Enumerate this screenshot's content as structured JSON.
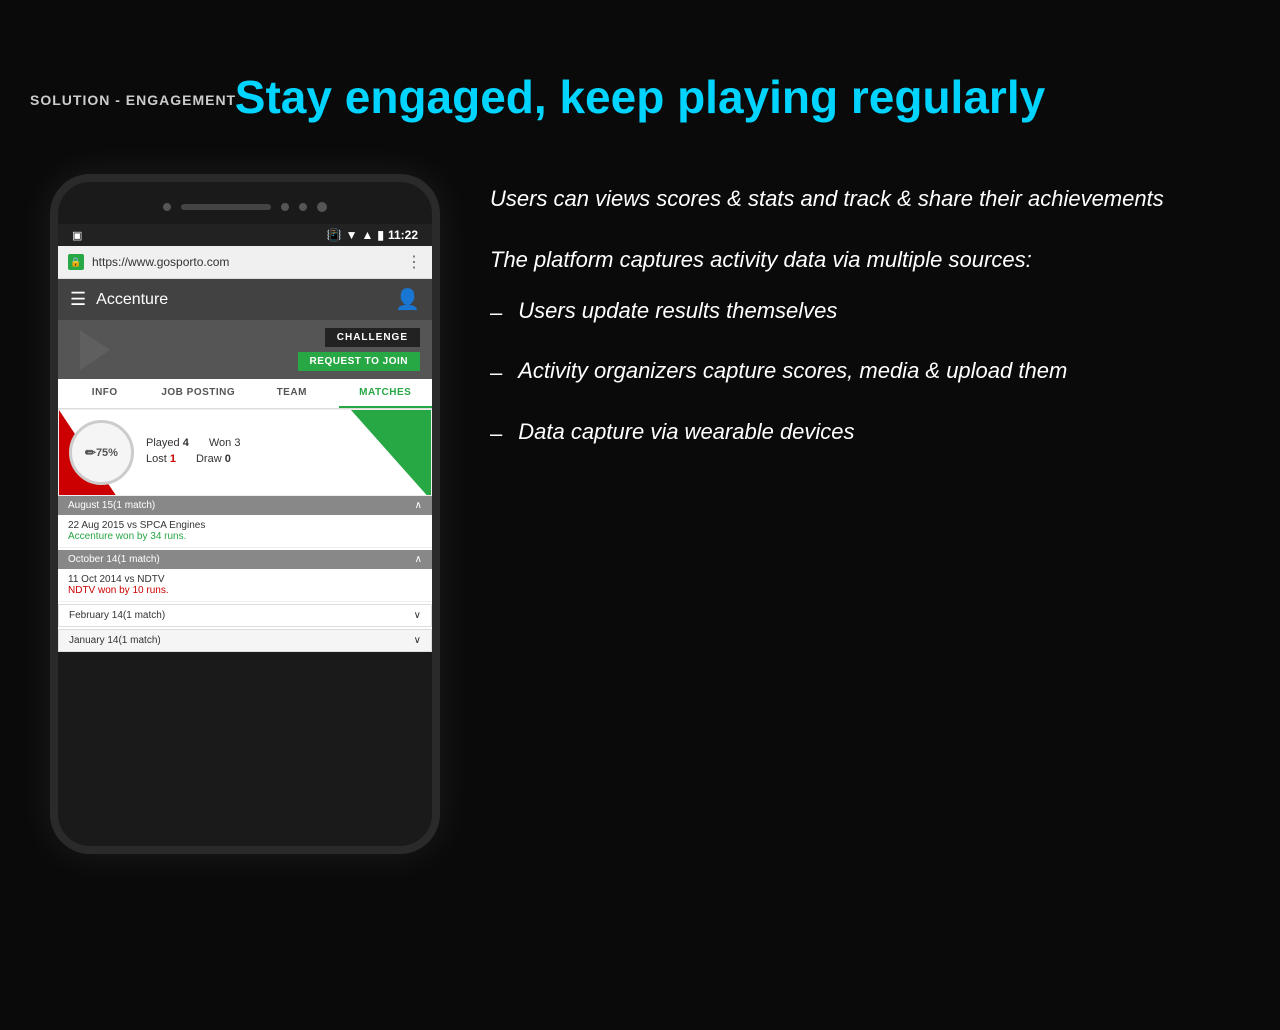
{
  "slide": {
    "label": "SOLUTION - ENGAGEMENT",
    "title": "Stay engaged, keep playing regularly"
  },
  "phone": {
    "top_dots": [
      "dot1",
      "dot2"
    ],
    "status_bar": {
      "time": "11:22"
    },
    "browser": {
      "url": "https://www.gosporto.com"
    },
    "app": {
      "title": "Accenture"
    },
    "buttons": {
      "challenge": "CHALLENGE",
      "request": "REQUEST TO JOIN"
    },
    "tabs": [
      {
        "label": "INFO",
        "active": false
      },
      {
        "label": "JOB POSTING",
        "active": false
      },
      {
        "label": "TEAM",
        "active": false
      },
      {
        "label": "MATCHES",
        "active": true
      }
    ],
    "stats": {
      "percent": "75%",
      "played_label": "Played",
      "played_val": "4",
      "won_label": "Won",
      "won_val": "3",
      "lost_label": "Lost",
      "lost_val": "1",
      "draw_label": "Draw",
      "draw_val": "0"
    },
    "matches": [
      {
        "month": "August 15(1 match)",
        "vs": "22 Aug 2015 vs SPCA Engines",
        "result": "Accenture won by 34 runs.",
        "result_type": "win"
      },
      {
        "month": "October 14(1 match)",
        "vs": "11 Oct 2014 vs NDTV",
        "result": "NDTV won by 10 runs.",
        "result_type": "loss"
      }
    ],
    "feb_row": "February 14(1 match)",
    "jan_row": "January 14(1 match)"
  },
  "right": {
    "intro": "Users can views scores & stats and track & share their achievements",
    "platform": "The platform captures activity data via multiple sources:",
    "bullets": [
      {
        "text": "Users update results themselves"
      },
      {
        "text": "Activity organizers capture scores, media & upload them"
      },
      {
        "text": "Data capture via wearable devices"
      }
    ]
  }
}
